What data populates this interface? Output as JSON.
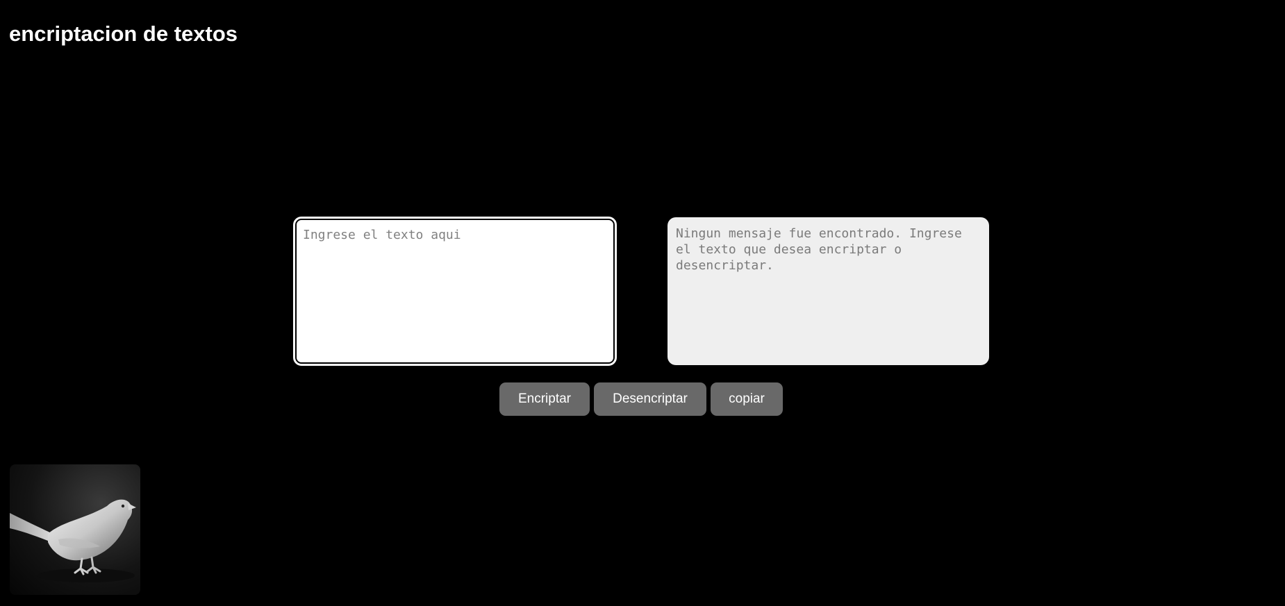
{
  "header": {
    "title": "encriptacion de textos"
  },
  "input": {
    "placeholder": "Ingrese el texto aqui",
    "value": ""
  },
  "output": {
    "placeholder": "Ningun mensaje fue encontrado. Ingrese el texto que desea encriptar o desencriptar.",
    "value": ""
  },
  "actions": {
    "encrypt_label": "Encriptar",
    "decrypt_label": "Desencriptar",
    "copy_label": "copiar"
  },
  "image": {
    "subject": "bird-figurine"
  },
  "colors": {
    "background": "#000000",
    "button": "#696969",
    "output_background": "#efefef"
  }
}
